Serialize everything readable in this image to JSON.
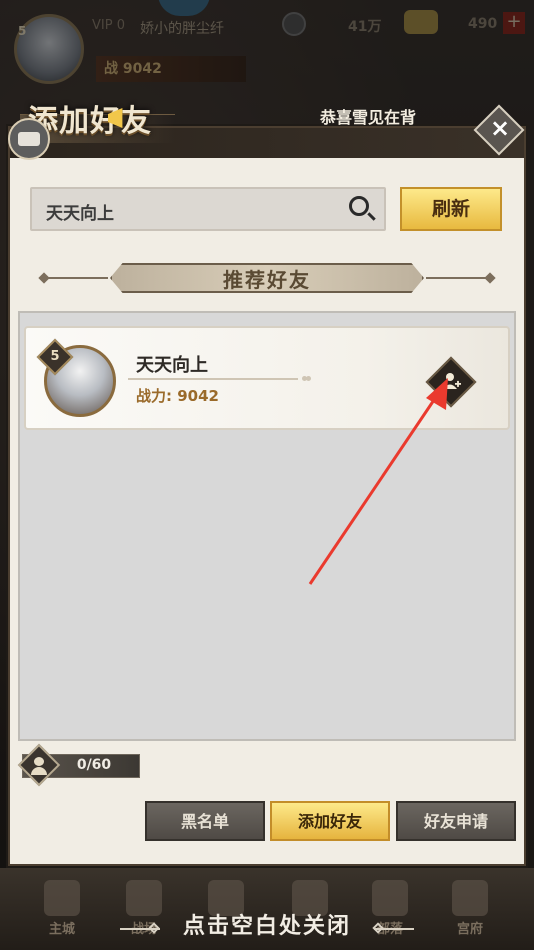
{
  "hud": {
    "level": "5",
    "vip": "VIP 0",
    "player_name": "娇小的胖尘纤",
    "power": "战 9042",
    "coins": "41万",
    "gold": "490",
    "plus": "+"
  },
  "dialog": {
    "title": "添加好友",
    "marquee": "恭喜雪见在背",
    "close": "×"
  },
  "search": {
    "value": "天天向上",
    "refresh_label": "刷新"
  },
  "section": {
    "title": "推荐好友"
  },
  "friends": [
    {
      "level": "5",
      "name": "天天向上",
      "power": "战力: 9042"
    }
  ],
  "capacity": "0/60",
  "tabs": [
    {
      "label": "黑名单",
      "active": false
    },
    {
      "label": "添加好友",
      "active": true
    },
    {
      "label": "好友申请",
      "active": false
    }
  ],
  "bottom_nav": {
    "items": [
      "主城",
      "战场",
      "",
      "",
      "部落",
      "宫府"
    ],
    "close_hint": "点击空白处关闭"
  },
  "colors": {
    "accent_gold": "#e8b93f",
    "annotation_arrow": "#ea3a2e"
  }
}
